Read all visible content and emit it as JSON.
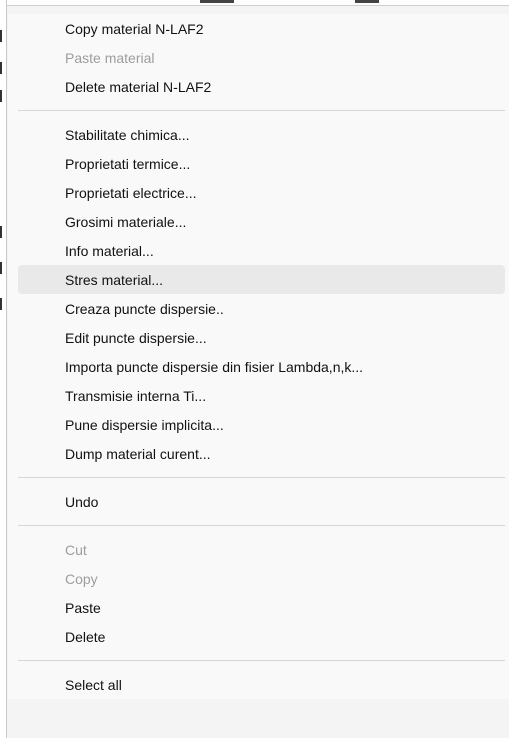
{
  "menu": {
    "groups": [
      {
        "items": [
          {
            "label": "Copy material N-LAF2",
            "enabled": true
          },
          {
            "label": "Paste material",
            "enabled": false
          },
          {
            "label": "Delete material N-LAF2",
            "enabled": true
          }
        ]
      },
      {
        "items": [
          {
            "label": "Stabilitate chimica...",
            "enabled": true
          },
          {
            "label": "Proprietati termice...",
            "enabled": true
          },
          {
            "label": "Proprietati electrice...",
            "enabled": true
          },
          {
            "label": "Grosimi materiale...",
            "enabled": true
          },
          {
            "label": "Info material...",
            "enabled": true
          },
          {
            "label": "Stres material...",
            "enabled": true,
            "highlighted": true
          },
          {
            "label": "Creaza puncte dispersie..",
            "enabled": true
          },
          {
            "label": "Edit puncte dispersie...",
            "enabled": true
          },
          {
            "label": "Importa puncte dispersie din fisier Lambda,n,k...",
            "enabled": true
          },
          {
            "label": "Transmisie interna Ti...",
            "enabled": true
          },
          {
            "label": "Pune dispersie implicita...",
            "enabled": true
          },
          {
            "label": "Dump material curent...",
            "enabled": true
          }
        ]
      },
      {
        "items": [
          {
            "label": "Undo",
            "enabled": true
          }
        ]
      },
      {
        "items": [
          {
            "label": "Cut",
            "enabled": false
          },
          {
            "label": "Copy",
            "enabled": false
          },
          {
            "label": "Paste",
            "enabled": true
          },
          {
            "label": "Delete",
            "enabled": true
          }
        ]
      },
      {
        "items": [
          {
            "label": "Select all",
            "enabled": true
          }
        ]
      }
    ]
  },
  "colors": {
    "text": "#111111",
    "disabled_text": "#9d9d9d",
    "highlight": "#e9e9e9",
    "separator": "#d6d6d6",
    "menu_background": "#f9f9f9"
  }
}
